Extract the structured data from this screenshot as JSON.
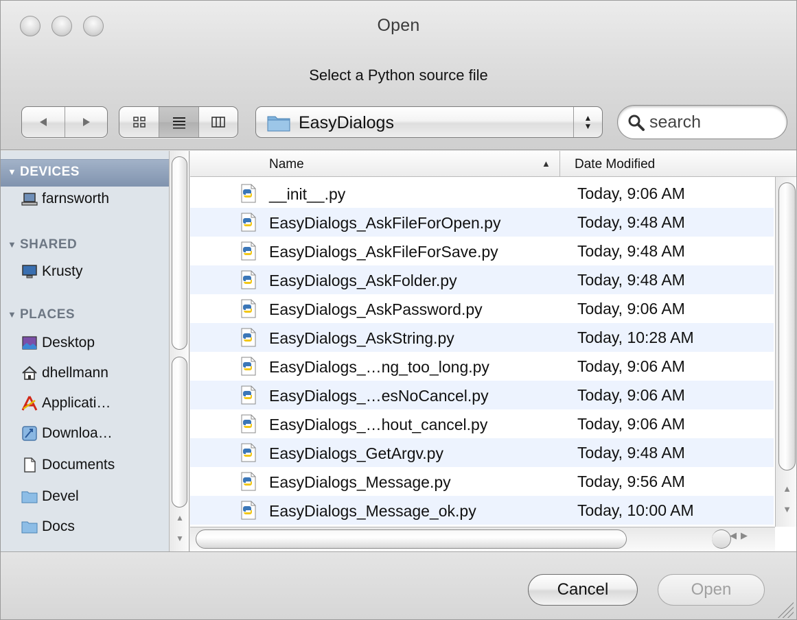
{
  "window": {
    "title": "Open",
    "prompt": "Select a Python source file"
  },
  "toolbar": {
    "back_icon": "back-arrow-icon",
    "forward_icon": "forward-arrow-icon",
    "view_modes": [
      "icon-view",
      "list-view",
      "column-view"
    ],
    "active_view": "list-view",
    "location": "EasyDialogs",
    "search_placeholder": "search"
  },
  "sidebar": {
    "sections": [
      {
        "label": "DEVICES",
        "items": [
          {
            "label": "farnsworth",
            "icon": "laptop-icon"
          }
        ]
      },
      {
        "label": "SHARED",
        "items": [
          {
            "label": "Krusty",
            "icon": "computer-icon"
          }
        ]
      },
      {
        "label": "PLACES",
        "items": [
          {
            "label": "Desktop",
            "icon": "desktop-icon"
          },
          {
            "label": "dhellmann",
            "icon": "home-icon"
          },
          {
            "label": "Applicati…",
            "icon": "applications-icon"
          },
          {
            "label": "Downloa…",
            "icon": "downloads-icon"
          },
          {
            "label": "Documents",
            "icon": "documents-icon"
          },
          {
            "label": "Devel",
            "icon": "folder-icon"
          },
          {
            "label": "Docs",
            "icon": "folder-icon"
          }
        ]
      }
    ]
  },
  "filelist": {
    "columns": {
      "name": "Name",
      "date": "Date Modified"
    },
    "rows": [
      {
        "name": "__init__.py",
        "date": "Today, 9:06 AM"
      },
      {
        "name": "EasyDialogs_AskFileForOpen.py",
        "date": "Today, 9:48 AM"
      },
      {
        "name": "EasyDialogs_AskFileForSave.py",
        "date": "Today, 9:48 AM"
      },
      {
        "name": "EasyDialogs_AskFolder.py",
        "date": "Today, 9:48 AM"
      },
      {
        "name": "EasyDialogs_AskPassword.py",
        "date": "Today, 9:06 AM"
      },
      {
        "name": "EasyDialogs_AskString.py",
        "date": "Today, 10:28 AM"
      },
      {
        "name": "EasyDialogs_…ng_too_long.py",
        "date": "Today, 9:06 AM"
      },
      {
        "name": "EasyDialogs_…esNoCancel.py",
        "date": "Today, 9:06 AM"
      },
      {
        "name": "EasyDialogs_…hout_cancel.py",
        "date": "Today, 9:06 AM"
      },
      {
        "name": "EasyDialogs_GetArgv.py",
        "date": "Today, 9:48 AM"
      },
      {
        "name": "EasyDialogs_Message.py",
        "date": "Today, 9:56 AM"
      },
      {
        "name": "EasyDialogs_Message_ok.py",
        "date": "Today, 10:00 AM"
      }
    ]
  },
  "buttons": {
    "cancel": "Cancel",
    "open": "Open"
  },
  "colors": {
    "sidebar_bg": "#dee4ea",
    "row_alt": "#edf3fe",
    "section_head": "#6d7784"
  }
}
